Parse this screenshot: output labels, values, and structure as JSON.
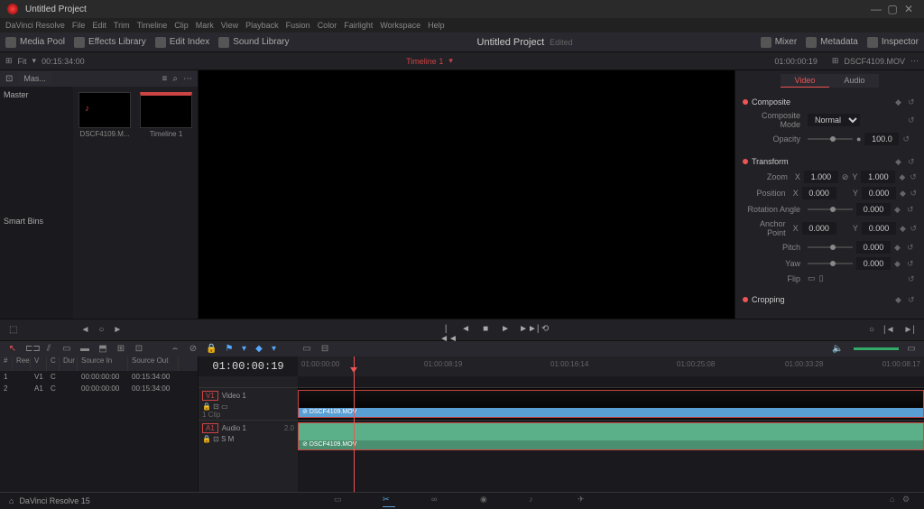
{
  "title": "Untitled Project",
  "menu": [
    "DaVinci Resolve",
    "File",
    "Edit",
    "Trim",
    "Timeline",
    "Clip",
    "Mark",
    "View",
    "Playback",
    "Fusion",
    "Color",
    "Fairlight",
    "Workspace",
    "Help"
  ],
  "topTools": {
    "mediaPool": "Media Pool",
    "effects": "Effects Library",
    "editIndex": "Edit Index",
    "sound": "Sound Library",
    "mixer": "Mixer",
    "metadata": "Metadata",
    "inspector": "Inspector"
  },
  "project": {
    "name": "Untitled Project",
    "status": "Edited"
  },
  "toolbar2": {
    "fit": "Fit",
    "srcDur": "00:15:34:00",
    "timeline": "Timeline 1",
    "tc": "01:00:00:19",
    "clipName": "DSCF4109.MOV"
  },
  "media": {
    "binTab": "Mas...",
    "master": "Master",
    "smartBins": "Smart Bins",
    "thumbs": [
      {
        "name": "DSCF4109.M..."
      },
      {
        "name": "Timeline 1"
      }
    ]
  },
  "inspector": {
    "tabs": {
      "video": "Video",
      "audio": "Audio"
    },
    "composite": {
      "title": "Composite",
      "modeLabel": "Composite Mode",
      "mode": "Normal",
      "opacityLabel": "Opacity",
      "opacity": "100.0"
    },
    "transform": {
      "title": "Transform",
      "zoom": "Zoom",
      "x": "X",
      "y": "Y",
      "zoomX": "1.000",
      "zoomY": "1.000",
      "position": "Position",
      "posX": "0.000",
      "posY": "0.000",
      "rotLabel": "Rotation Angle",
      "rot": "0.000",
      "anchorLabel": "Anchor Point",
      "anchX": "0.000",
      "anchY": "0.000",
      "pitchLabel": "Pitch",
      "pitch": "0.000",
      "yawLabel": "Yaw",
      "yaw": "0.000",
      "flipLabel": "Flip"
    },
    "cropping": {
      "title": "Cropping"
    }
  },
  "editIndex": {
    "cols": {
      "num": "#",
      "ree": "Ree",
      "v": "V",
      "c": "C",
      "dur": "Dur",
      "srcIn": "Source In",
      "srcOut": "Source Out"
    },
    "rows": [
      {
        "num": "1",
        "v": "V1",
        "c": "C",
        "in": "00:00:00:00",
        "out": "00:15:34:00"
      },
      {
        "num": "2",
        "v": "A1",
        "c": "C",
        "in": "00:00:00:00",
        "out": "00:15:34:00"
      }
    ]
  },
  "timeline": {
    "tc": "01:00:00:19",
    "marks": {
      "m1": "01:00:00:00",
      "m2": "01:00:08:19",
      "m3": "01:00:16:14",
      "m4": "01:00:25:08",
      "m5": "01:00:33:28",
      "m6": "01:00:08:17"
    },
    "video": {
      "badge": "V1",
      "name": "Video 1",
      "clips": "1 Clip",
      "clip": "DSCF4109.MOV"
    },
    "audio": {
      "badge": "A1",
      "name": "Audio 1",
      "ch": "2.0",
      "clip": "DSCF4109.MOV"
    }
  },
  "footer": {
    "app": "DaVinci Resolve 15"
  }
}
